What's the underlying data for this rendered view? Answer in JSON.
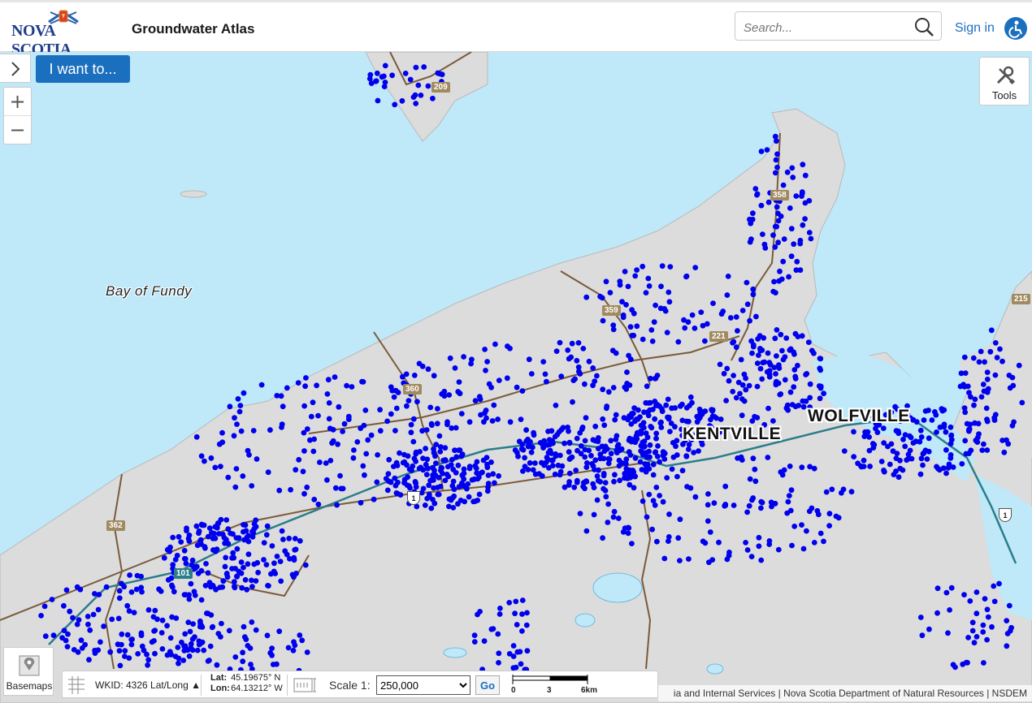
{
  "header": {
    "logo_text": "NOVA SCOTIA",
    "app_title": "Groundwater Atlas",
    "search_placeholder": "Search...",
    "sign_in": "Sign in",
    "accessibility_icon": "accessibility-icon"
  },
  "controls": {
    "panel_toggle_icon": "chevron-right-icon",
    "i_want_to": "I want to...",
    "zoom_in": "+",
    "zoom_out": "−",
    "tools": "Tools",
    "basemaps": "Basemaps"
  },
  "map": {
    "water_label": "Bay of Fundy",
    "places": [
      "KENTVILLE",
      "WOLFVILLE"
    ],
    "highways": [
      "209",
      "358",
      "359",
      "221",
      "360",
      "362",
      "215",
      "101"
    ],
    "trunk_shields": [
      "1",
      "1"
    ],
    "colors": {
      "water": "#bfe8f8",
      "land": "#dcdcdc",
      "well_points": "#0000ee",
      "roads": "#7a5a3a",
      "highway": "#2a7d8a"
    }
  },
  "status": {
    "wkid": "WKID: 4326 Lat/Long",
    "lat_label": "Lat:",
    "lat_value": "45.19675° N",
    "lon_label": "Lon:",
    "lon_value": "64.13212° W",
    "scale_label": "Scale 1:",
    "scale_value": "250,000",
    "go": "Go",
    "scalebar_ticks": [
      "0",
      "3",
      "6km"
    ]
  },
  "attribution": "ia and Internal Services | Nova Scotia Department of Natural Resources | NSDEM"
}
